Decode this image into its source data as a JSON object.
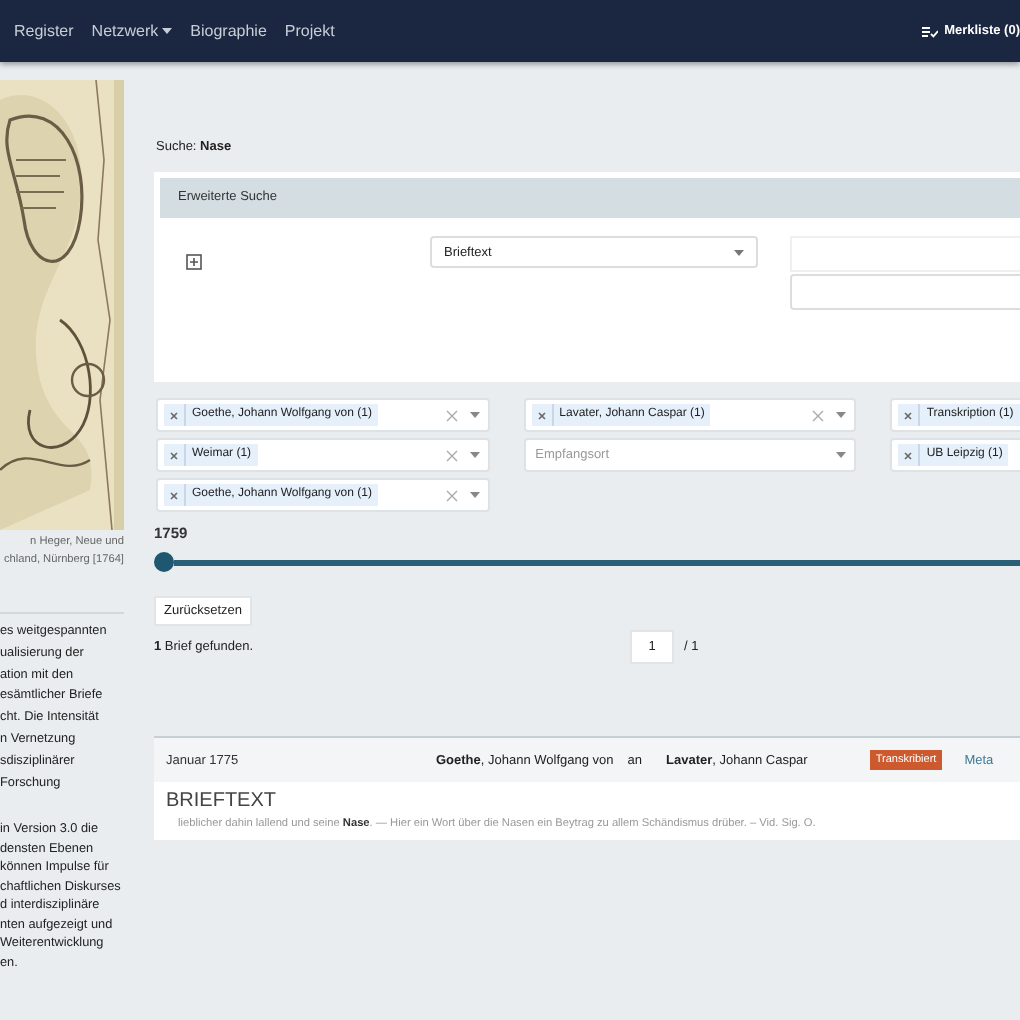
{
  "navbar": {
    "items": [
      {
        "label": "Register",
        "dropdown": false
      },
      {
        "label": "Netzwerk",
        "dropdown": true
      },
      {
        "label": "Biographie",
        "dropdown": false
      },
      {
        "label": "Projekt",
        "dropdown": false
      }
    ],
    "merkliste": "Merkliste (0)"
  },
  "sidebar": {
    "image": {
      "kind": "picture"
    },
    "caption_lines": [
      "n Heger, Neue und",
      "chland, Nürnberg [1764]"
    ],
    "paragraphs": [
      {
        "lines": [
          "es weitgespannten",
          "ualisierung der",
          "ation mit den",
          "esämtlicher Briefe",
          "cht. Die Intensität",
          "n Vernetzung",
          "sdisziplinärer",
          "Forschung"
        ]
      },
      {
        "lines": [
          "in Version 3.0 die",
          "densten Ebenen",
          "können Impulse für",
          "chaftlichen Diskurses",
          "d interdisziplinäre",
          "nten aufgezeigt und",
          "Weiterentwicklung",
          "en."
        ]
      }
    ]
  },
  "search": {
    "query": "Suche: **Nase**"
  },
  "advanced_search": {
    "title": "Erweiterte Suche",
    "field_select": "Brieftext"
  },
  "filters": [
    [
      {
        "kind": "chips",
        "clearable": true,
        "chips": [
          "Goethe, Johann Wolfgang von (1)"
        ]
      },
      {
        "kind": "chips",
        "clearable": true,
        "chips": [
          "Weimar (1)"
        ]
      },
      {
        "kind": "chips",
        "clearable": true,
        "chips": [
          "Goethe, Johann Wolfgang von (1)"
        ]
      }
    ],
    [
      {
        "kind": "chips",
        "clearable": true,
        "chips": [
          "Lavater, Johann Caspar (1)"
        ]
      },
      {
        "kind": "empty",
        "placeholder": "Empfangsort"
      }
    ],
    [
      {
        "kind": "chips",
        "chips": [
          "Transkription (1)"
        ]
      },
      {
        "kind": "chips",
        "chips": [
          "UB Leipzig (1)"
        ]
      }
    ]
  ],
  "timeline": {
    "year": "1759",
    "level": 0
  },
  "reset_button": "Zurücksetzen",
  "results": {
    "count_text": "**1** Brief gefunden.",
    "page": "1",
    "pages": "/ 1"
  },
  "letters": [
    {
      "date": "Januar 1775",
      "sender": "**Goethe**, Johann Wolfgang von",
      "connector": "an",
      "recipient": "**Lavater**, Johann Caspar",
      "status": "Transkribiert",
      "link": "Meta",
      "section": "BRIEFTEXT",
      "snippets": [
        "lieblicher dahin lallend und seine **Nase**. — Hier ein Wort über die Nasen ein Beytrag zu allem Schändismus drüber. – Vid. Sig. O."
      ]
    }
  ]
}
